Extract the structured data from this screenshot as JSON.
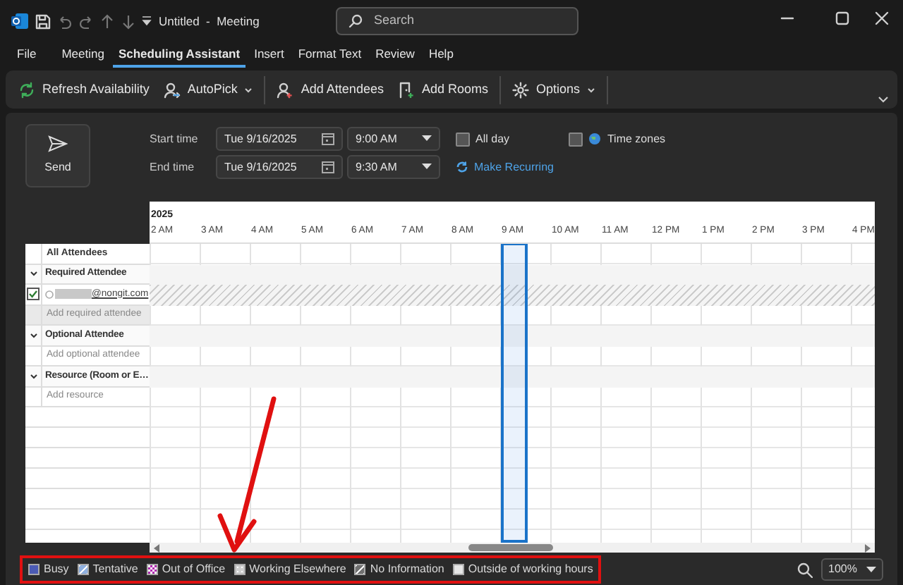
{
  "window": {
    "title": "Untitled  -  Meeting"
  },
  "search": {
    "placeholder": "Search"
  },
  "menu_tabs": [
    {
      "label": "File",
      "selected": false
    },
    {
      "label": "Meeting",
      "selected": false
    },
    {
      "label": "Scheduling Assistant",
      "selected": true
    },
    {
      "label": "Insert",
      "selected": false
    },
    {
      "label": "Format Text",
      "selected": false
    },
    {
      "label": "Review",
      "selected": false
    },
    {
      "label": "Help",
      "selected": false
    }
  ],
  "ribbon": [
    {
      "kind": "button",
      "label": "Refresh Availability"
    },
    {
      "kind": "dropdown",
      "label": "AutoPick"
    },
    {
      "kind": "separator"
    },
    {
      "kind": "button",
      "label": "Add Attendees"
    },
    {
      "kind": "button",
      "label": "Add Rooms"
    },
    {
      "kind": "separator"
    },
    {
      "kind": "dropdown",
      "label": "Options"
    },
    {
      "kind": "separator"
    }
  ],
  "send_button": {
    "label": "Send"
  },
  "start": {
    "label": "Start time",
    "date": "Tue 9/16/2025",
    "time": "9:00 AM"
  },
  "end": {
    "label": "End time",
    "date": "Tue 9/16/2025",
    "time": "9:30 AM"
  },
  "all_day": {
    "label": "All day",
    "checked": false
  },
  "time_zones": {
    "label": "Time zones",
    "checked": false
  },
  "make_recurring": {
    "label": "Make Recurring"
  },
  "timeline": {
    "year": "2025",
    "hours": [
      "2 AM",
      "3 AM",
      "4 AM",
      "5 AM",
      "6 AM",
      "7 AM",
      "8 AM",
      "9 AM",
      "10 AM",
      "11 AM",
      "12 PM",
      "1 PM",
      "2 PM",
      "3 PM",
      "4 PM"
    ]
  },
  "attendees": {
    "header": "All Attendees",
    "groups": [
      {
        "label": "Required Attendee",
        "expanded": true,
        "members": [
          {
            "email": "@nongit.com",
            "checked": true
          }
        ],
        "add_placeholder": "Add required attendee"
      },
      {
        "label": "Optional Attendee",
        "expanded": true,
        "add_placeholder": "Add optional attendee"
      },
      {
        "label": "Resource (Room or E…",
        "expanded": true,
        "add_placeholder": "Add resource"
      }
    ]
  },
  "legend": [
    {
      "label": "Busy",
      "kind": "solid",
      "color": "#4b5bb5"
    },
    {
      "label": "Tentative",
      "kind": "hatched",
      "color": "#8fb0e0"
    },
    {
      "label": "Out of Office",
      "kind": "checker",
      "color": "#b02ab0"
    },
    {
      "label": "Working Elsewhere",
      "kind": "dotted",
      "color": "#cfcfcf"
    },
    {
      "label": "No Information",
      "kind": "hatched",
      "color": "#707070"
    },
    {
      "label": "Outside of working hours",
      "kind": "solid",
      "color": "#e6e6e6"
    }
  ],
  "zoom": {
    "value": "100%"
  }
}
